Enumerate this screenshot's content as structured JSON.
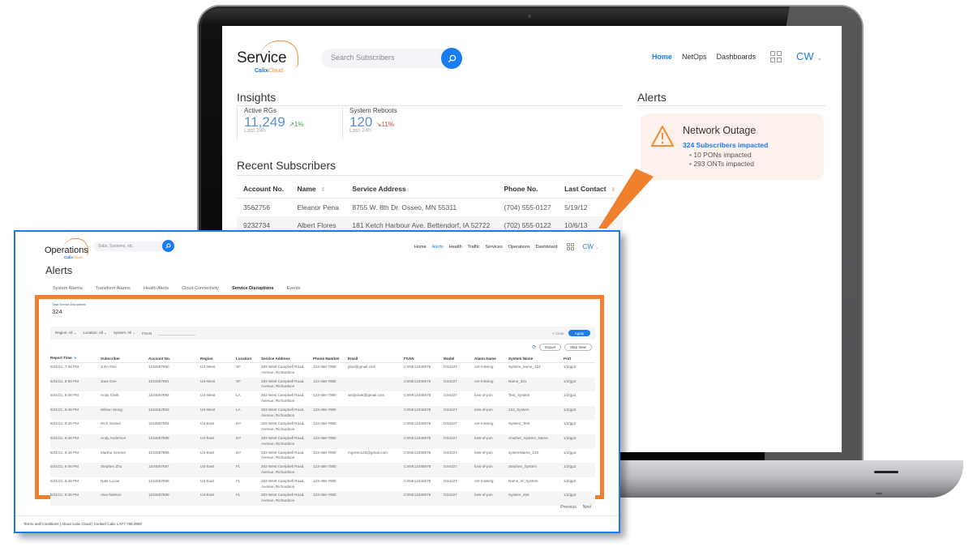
{
  "service_app": {
    "logo": {
      "word": "Service",
      "brand": "Calix",
      "brand_suffix": "Cloud"
    },
    "search_placeholder": "Search Subscribers",
    "nav": [
      {
        "label": "Home",
        "active": true
      },
      {
        "label": "NetOps",
        "active": false
      },
      {
        "label": "Dashboards",
        "active": false
      }
    ],
    "user_initials": "CW",
    "insights": {
      "title": "Insights",
      "cards": [
        {
          "label": "Active RGs",
          "value": "11,249",
          "change": "1%",
          "direction": "up",
          "period": "Last 24h"
        },
        {
          "label": "System Reboots",
          "value": "120",
          "change": "11%",
          "direction": "down",
          "period": "Last 24h"
        }
      ]
    },
    "recent_subscribers": {
      "title": "Recent Subscribers",
      "columns": [
        "Account No.",
        "Name",
        "Service Address",
        "Phone No.",
        "Last Contact"
      ],
      "rows": [
        [
          "3562756",
          "Eleanor Pena",
          "8755 W. 8th Dr. Osseo, MN 55311",
          "(704) 555-0127",
          "5/19/12"
        ],
        [
          "9232734",
          "Albert Flores",
          "181 Ketch Harbour Ave. Bettendorf, IA 52722",
          "(702) 555-0122",
          "10/6/13"
        ]
      ]
    },
    "alerts": {
      "title": "Alerts",
      "card": {
        "title": "Network Outage",
        "subscribers": "324 Subscribers impacted",
        "details": [
          "10 PONs impacted",
          "293 ONTs impacted"
        ]
      }
    }
  },
  "ops_app": {
    "logo": {
      "word": "Operations",
      "brand": "Calix",
      "brand_suffix": "Cloud"
    },
    "search_placeholder": "Subs, Systems, etc.",
    "nav": [
      {
        "label": "Home",
        "active": false
      },
      {
        "label": "Alerts",
        "active": true
      },
      {
        "label": "Health",
        "active": false
      },
      {
        "label": "Traffic",
        "active": false
      },
      {
        "label": "Services",
        "active": false
      },
      {
        "label": "Operations",
        "active": false
      },
      {
        "label": "Dashboard",
        "active": false
      }
    ],
    "user_initials": "CW",
    "page_title": "Alerts",
    "tabs": [
      {
        "label": "System Alarms",
        "active": false
      },
      {
        "label": "Transform Alarms",
        "active": false
      },
      {
        "label": "Health Alerts",
        "active": false
      },
      {
        "label": "Cloud Connectivity",
        "active": false
      },
      {
        "label": "Service Disruptions",
        "active": true
      },
      {
        "label": "Events",
        "active": false
      }
    ],
    "summary": {
      "label": "Total Service Disruptions",
      "value": "324"
    },
    "filters": {
      "region": "Region: All",
      "location": "Location: All",
      "system": "System: All",
      "fsan_label": "FSAN",
      "clear": "× Clear",
      "apply": "Apply"
    },
    "toolbar": {
      "export": "Export",
      "map_view": "Map View"
    },
    "table": {
      "columns": [
        "Report Time",
        "Subscriber",
        "Account No.",
        "Region",
        "Location",
        "Service Address",
        "Phone Number",
        "Email",
        "FSAN",
        "Model",
        "Alarm Name",
        "System Name",
        "Port"
      ],
      "rows": [
        [
          "5/31/21, 7:48 PM",
          "John Doe",
          "1234567890",
          "US-West",
          "SF",
          "283 West Campbell Road, Avenue, Richardson",
          "123-456-7890",
          "jdoe@gmail.com",
          "CXNK12345678",
          "GS4227",
          "ont-missing",
          "System_name_123",
          "1/2/gp2"
        ],
        [
          "5/31/21, 6:58 PM",
          "Jane Doe",
          "1234567891",
          "US-West",
          "SF",
          "283 West Campbell Road, Avenue, Richardson",
          "123-456-7890",
          "",
          "CXNK12345678",
          "GS4227",
          "ont-missing",
          "Name_321",
          "1/2/gp2"
        ],
        [
          "5/31/21, 6:48 PM",
          "Andy Clark",
          "1234567892",
          "US-West",
          "LA",
          "283 West Campbell Road, Avenue, Richardson",
          "123-456-7890",
          "andyclark@gmail.com",
          "CXNK12345678",
          "GS4227",
          "loss-of-pon",
          "Test_System",
          "1/2/gp2"
        ],
        [
          "5/31/21, 6:48 PM",
          "Wilson Wong",
          "1234567893",
          "US-West",
          "LA",
          "283 West Campbell Road, Avenue, Richardson",
          "123-456-7890",
          "",
          "CXNK12345678",
          "GS4227",
          "loss-of-pon",
          "123_System",
          "1/2/gp2"
        ],
        [
          "5/31/21, 6:48 PM",
          "Rich Gomez",
          "1234567894",
          "US-East",
          "NY",
          "283 West Campbell Road, Avenue, Richardson",
          "123-456-7890",
          "",
          "CXNK12345678",
          "GS4227",
          "ont-missing",
          "System_Test",
          "1/2/gp2"
        ],
        [
          "5/31/21, 6:48 PM",
          "Andy Anderson",
          "1234567895",
          "US-East",
          "NY",
          "283 West Campbell Road, Avenue, Richardson",
          "123-456-7890",
          "",
          "CXNK12345678",
          "GS4227",
          "loss-of-pon",
          "Another_System_Name",
          "1/2/gp2"
        ],
        [
          "5/31/21, 6:48 PM",
          "Martha Greene",
          "1234567896",
          "US-East",
          "NY",
          "283 West Campbell Road, Avenue, Richardson",
          "123-456-7890",
          "mgreen123@gmail.com",
          "CXNK12345678",
          "GS4227",
          "loss-of-pon",
          "systemName_133",
          "1/2/gp2"
        ],
        [
          "5/31/21, 6:48 PM",
          "Stephen Zhu",
          "1234567897",
          "US-East",
          "FL",
          "283 West Campbell Road, Avenue, Richardson",
          "123-456-7890",
          "",
          "CXNK12345678",
          "GS4227",
          "loss-of-pon",
          "Stephen_System",
          "1/2/gp2"
        ],
        [
          "5/31/21, 6:48 PM",
          "Nate Lucas",
          "1234567898",
          "US-East",
          "FL",
          "283 West Campbell Road, Avenue, Richardson",
          "123-456-7890",
          "",
          "CXNK12345678",
          "GS4227",
          "ont-missing",
          "Name_of_System",
          "1/2/gp2"
        ],
        [
          "5/31/21, 6:48 PM",
          "Alex Nielson",
          "1234567899",
          "US-East",
          "FL",
          "283 West Campbell Road, Avenue, Richardson",
          "123-456-7890",
          "",
          "CXNK12345678",
          "GS4227",
          "loss-of-pon",
          "System_456",
          "1/2/gp2"
        ]
      ]
    },
    "pager": {
      "previous": "Previous",
      "next": "Next"
    },
    "footer": "Terms and Conditions  |  About Calix Cloud  |  Contact Calix 1.877.768.2800"
  },
  "colors": {
    "accent": "#1a7cf2",
    "highlight": "#f07f2e",
    "alert_bg": "#fdf1ec",
    "up": "#3f9a3f",
    "down": "#d63a3a"
  }
}
